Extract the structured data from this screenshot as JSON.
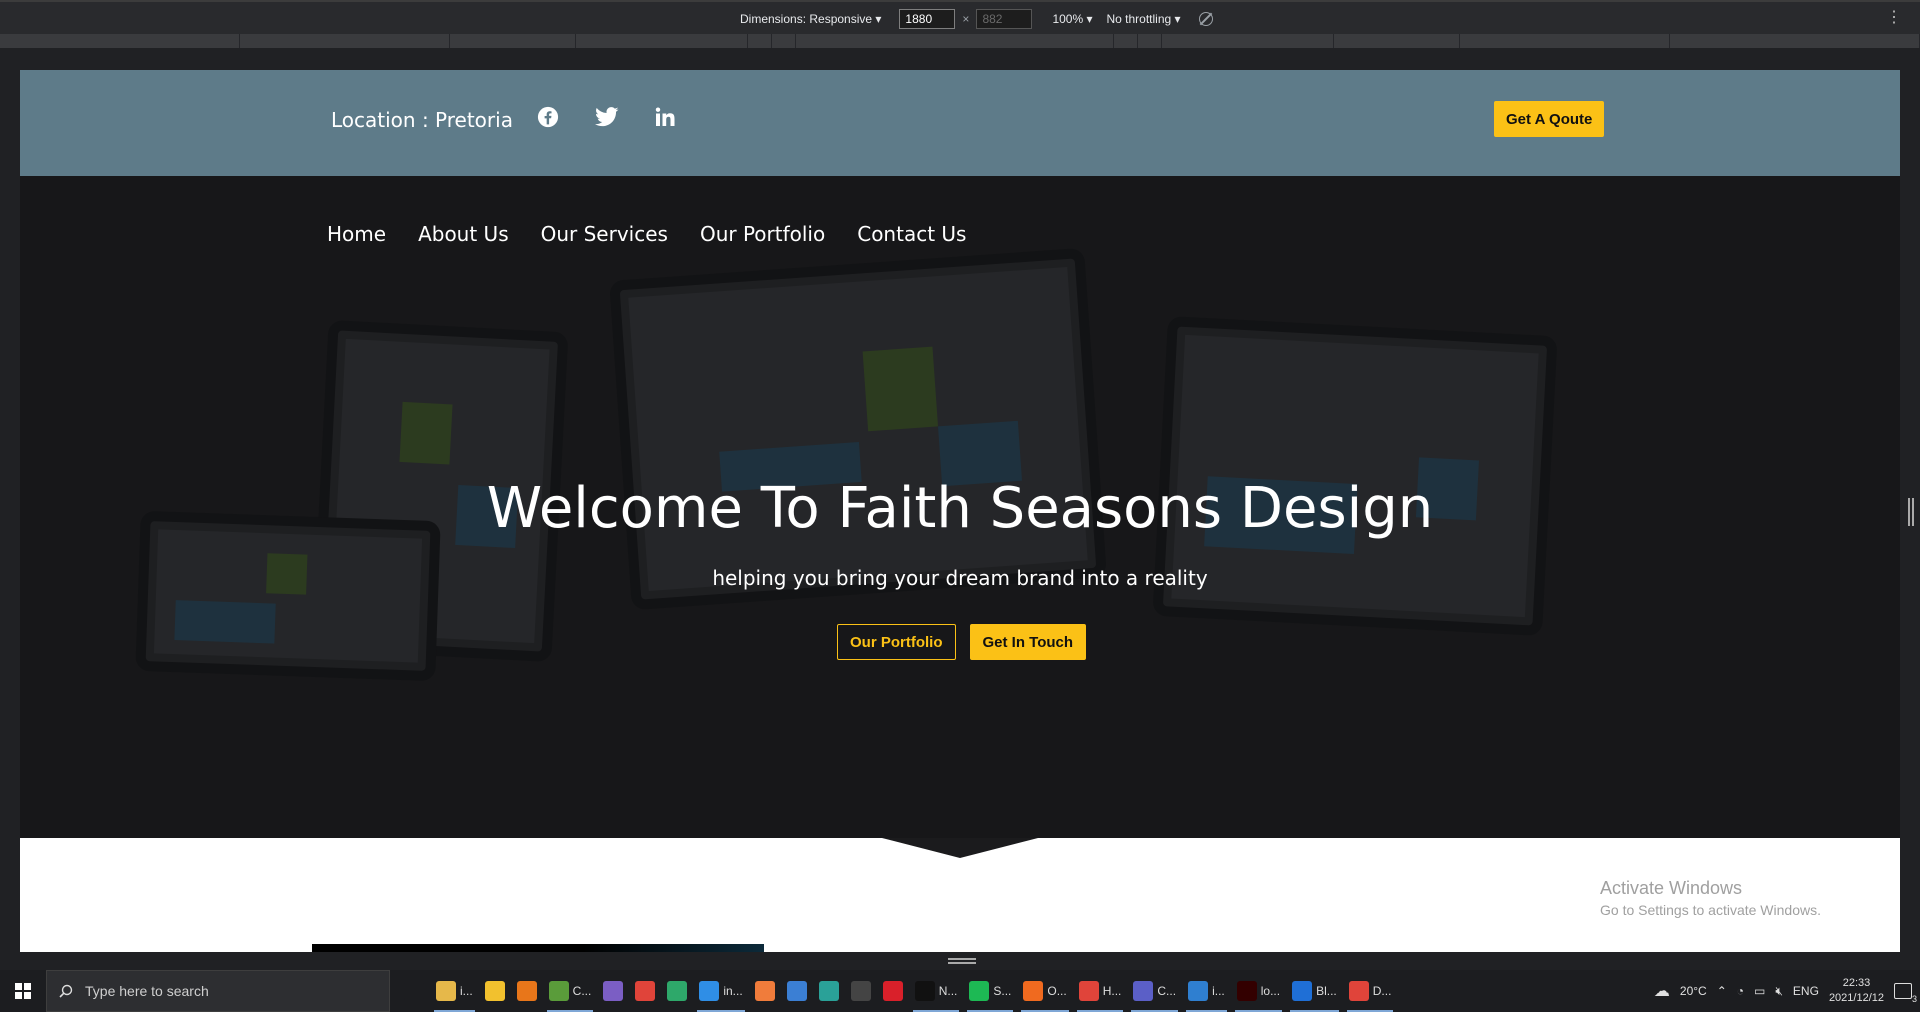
{
  "devtools": {
    "dimensions_label": "Dimensions: Responsive",
    "width_value": "1880",
    "times": "×",
    "height_value": "882",
    "zoom": "100%",
    "throttling": "No throttling",
    "rotate_icon": "rotate-icon",
    "more_icon": "kebab-icon"
  },
  "site": {
    "topbar": {
      "location": "Location : Pretoria",
      "social": [
        "facebook-icon",
        "twitter-icon",
        "linkedin-icon"
      ],
      "quote_button": "Get A Qoute"
    },
    "nav": [
      "Home",
      "About Us",
      "Our Services",
      "Our Portfolio",
      "Contact Us"
    ],
    "hero": {
      "title": "Welcome To Faith Seasons Design",
      "subtitle": "helping you bring your dream brand into a reality",
      "portfolio_button": "Our Portfolio",
      "contact_button": "Get In Touch"
    },
    "colors": {
      "accent": "#fbc116",
      "topbar": "#5e7b89",
      "hero_bg": "#1b1b1d"
    }
  },
  "watermark": {
    "line1": "Activate Windows",
    "line2": "Go to Settings to activate Windows."
  },
  "taskbar": {
    "search_placeholder": "Type here to search",
    "apps": [
      {
        "label": "",
        "icon": "task-view-icon",
        "color": "#1c1d20"
      },
      {
        "label": "i...",
        "icon": "file-explorer-icon",
        "color": "#e6b84a"
      },
      {
        "label": "",
        "icon": "media-player-icon",
        "color": "#f2c12e"
      },
      {
        "label": "",
        "icon": "vlc-icon",
        "color": "#e8761a"
      },
      {
        "label": "C...",
        "icon": "cmd-icon",
        "color": "#5a9c3a"
      },
      {
        "label": "",
        "icon": "visual-studio-icon",
        "color": "#7b5ec4"
      },
      {
        "label": "",
        "icon": "chrome-icon",
        "color": "#e0443a"
      },
      {
        "label": "",
        "icon": "maps-icon",
        "color": "#2ea86a"
      },
      {
        "label": "in...",
        "icon": "vscode-icon",
        "color": "#2f8ee6"
      },
      {
        "label": "",
        "icon": "xampp-icon",
        "color": "#f07c3b"
      },
      {
        "label": "",
        "icon": "music-note-icon",
        "color": "#3b7fd4"
      },
      {
        "label": "",
        "icon": "three-icon",
        "color": "#2aa198"
      },
      {
        "label": "",
        "icon": "unity-icon",
        "color": "#444"
      },
      {
        "label": "",
        "icon": "opera-icon",
        "color": "#d9202a"
      },
      {
        "label": "N...",
        "icon": "netflix-icon",
        "color": "#111"
      },
      {
        "label": "S...",
        "icon": "spotify-icon",
        "color": "#1db954"
      },
      {
        "label": "O...",
        "icon": "origin-icon",
        "color": "#f06a1f"
      },
      {
        "label": "H...",
        "icon": "chrome-icon",
        "color": "#e0443a"
      },
      {
        "label": "C...",
        "icon": "teams-icon",
        "color": "#5b5fc7"
      },
      {
        "label": "i...",
        "icon": "photos-icon",
        "color": "#2f7fd0"
      },
      {
        "label": "lo...",
        "icon": "illustrator-icon",
        "color": "#330000"
      },
      {
        "label": "Bl...",
        "icon": "bluetooth-icon",
        "color": "#1f6fd6"
      },
      {
        "label": "D...",
        "icon": "chrome-icon",
        "color": "#e0443a"
      }
    ],
    "open_indexes": [
      1,
      4,
      8,
      14,
      15,
      16,
      17,
      18,
      19,
      20,
      21,
      22
    ],
    "tray": {
      "weather": "20°C",
      "language": "ENG",
      "time": "22:33",
      "date": "2021/12/12",
      "notifications": "3"
    }
  }
}
